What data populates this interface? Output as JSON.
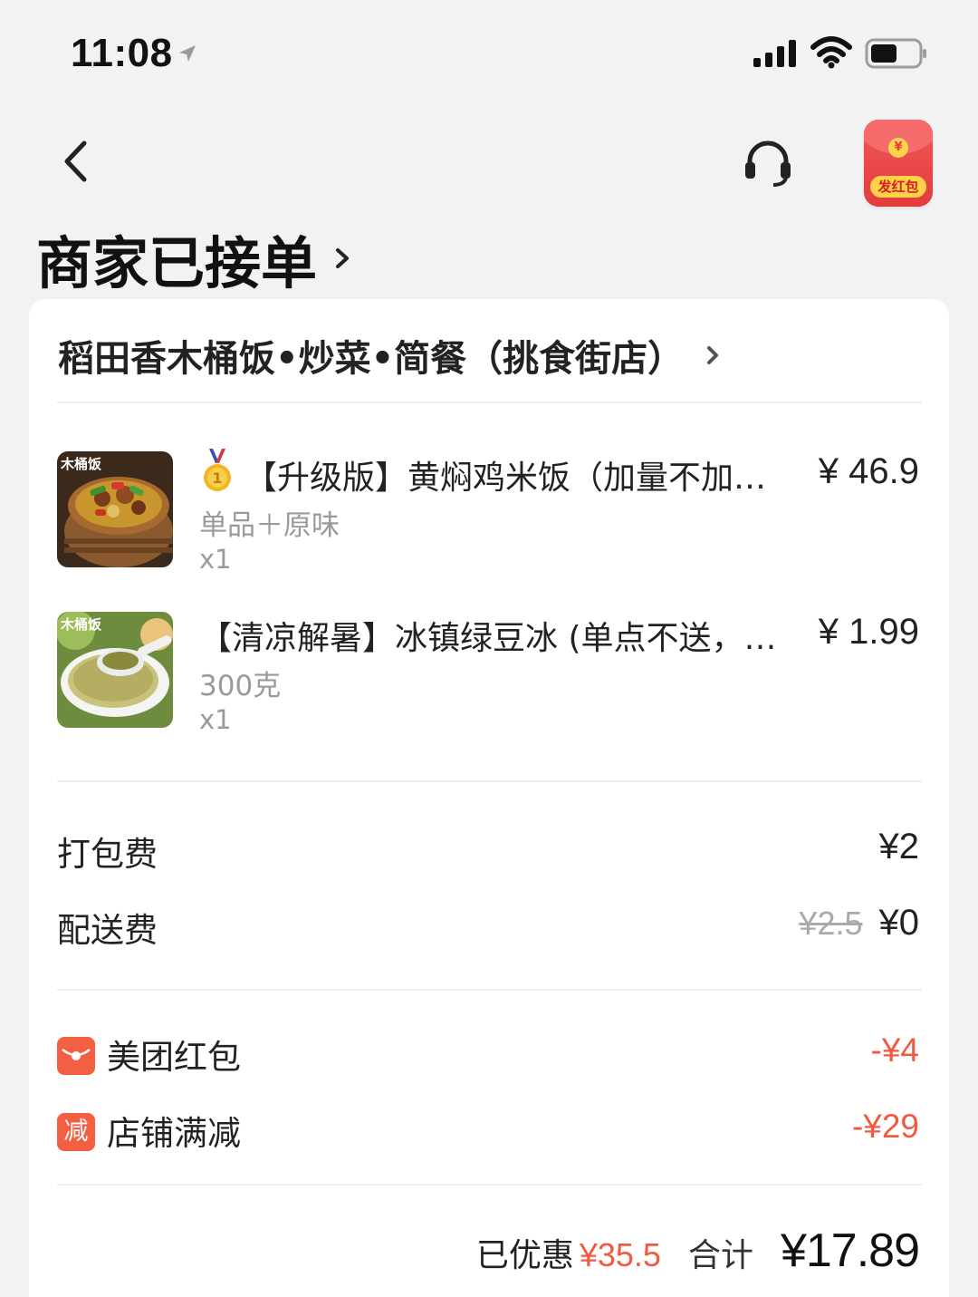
{
  "status_bar": {
    "time": "11:08"
  },
  "header": {
    "order_status": "商家已接单",
    "red_packet_label": "发红包",
    "red_packet_coin": "¥"
  },
  "shop": {
    "name": "稻田香木桶饭•炒菜•简餐（挑食街店）"
  },
  "items": [
    {
      "name": "【升级版】黄焖鸡米饭（加量不加…",
      "spec": "单品＋原味",
      "qty": "x1",
      "price": "¥ 46.9",
      "badge": "gold-medal-icon",
      "thumb_label": "木桶饭"
    },
    {
      "name": "【清凉解暑】冰镇绿豆冰 (单点不送，…",
      "spec": "300克",
      "qty": "x1",
      "price": "¥ 1.99",
      "thumb_label": "木桶饭"
    }
  ],
  "fees": {
    "packing": {
      "label": "打包费",
      "value": "¥2"
    },
    "delivery": {
      "label": "配送费",
      "original": "¥2.5",
      "value": "¥0"
    }
  },
  "discounts": [
    {
      "icon": "red-packet-icon",
      "label": "美团红包",
      "value": "-¥4"
    },
    {
      "icon_text": "减",
      "label": "店铺满减",
      "value": "-¥29"
    }
  ],
  "summary": {
    "saved_label": "已优惠",
    "saved_value": "¥35.5",
    "total_label": "合计",
    "total_value": "¥17.89"
  },
  "colors": {
    "accent": "#f05a41",
    "red_packet": "#e23b3b",
    "background": "#f2f2f2"
  }
}
